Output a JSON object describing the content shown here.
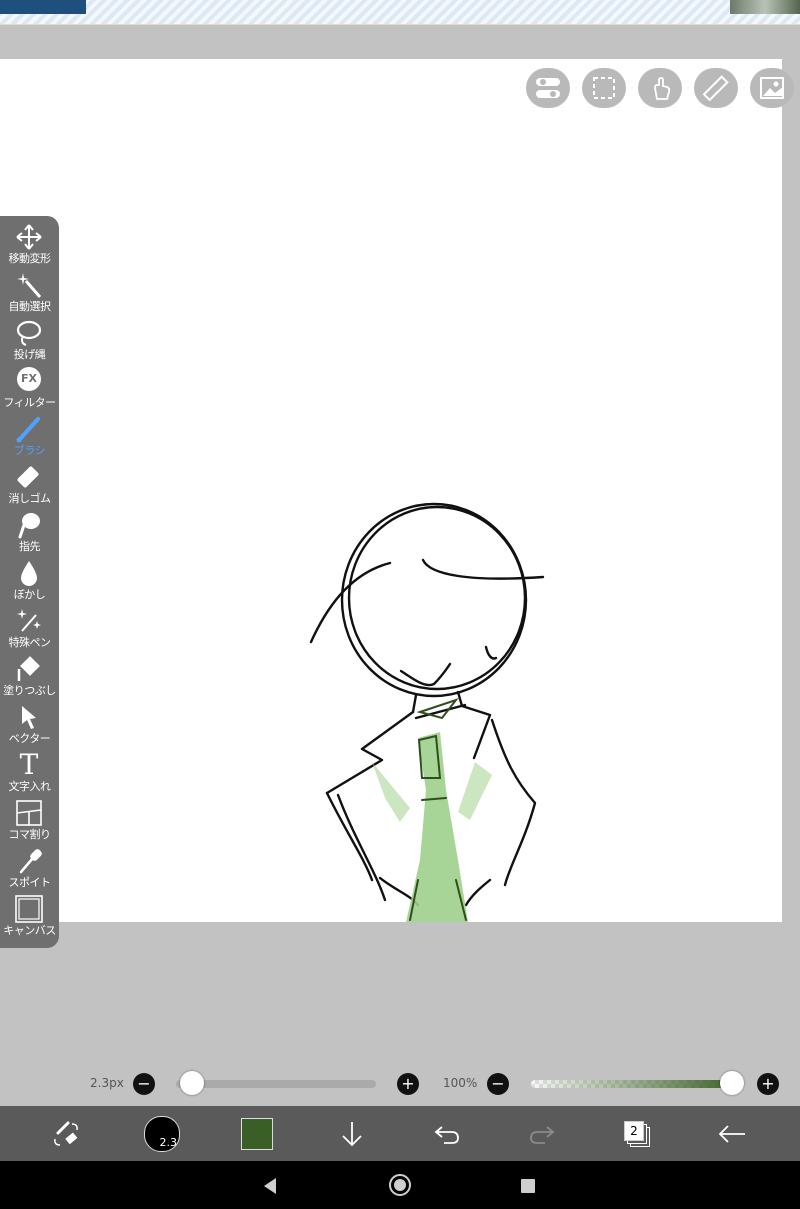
{
  "canvas_buttons": [
    "layer-toggle-icon",
    "selection-icon",
    "touch-icon",
    "ruler-icon",
    "image-icon"
  ],
  "tools": [
    {
      "label": "移動変形",
      "icon": "move-icon"
    },
    {
      "label": "自動選択",
      "icon": "magic-wand-icon"
    },
    {
      "label": "投げ縄",
      "icon": "lasso-icon"
    },
    {
      "label": "フィルター",
      "icon": "filter-icon",
      "glyph": "FX"
    },
    {
      "label": "ブラシ",
      "icon": "brush-icon",
      "active": true
    },
    {
      "label": "消しゴム",
      "icon": "eraser-icon"
    },
    {
      "label": "指先",
      "icon": "smudge-icon"
    },
    {
      "label": "ぼかし",
      "icon": "blur-icon"
    },
    {
      "label": "特殊ペン",
      "icon": "special-pen-icon"
    },
    {
      "label": "塗りつぶし",
      "icon": "fill-icon"
    },
    {
      "label": "ベクター",
      "icon": "vector-icon"
    },
    {
      "label": "文字入れ",
      "icon": "text-icon",
      "glyph": "T"
    },
    {
      "label": "コマ割り",
      "icon": "frame-divider-icon"
    },
    {
      "label": "スポイト",
      "icon": "eyedropper-icon"
    },
    {
      "label": "キャンバス",
      "icon": "canvas-icon"
    }
  ],
  "brush": {
    "size_label": "2.3px",
    "size_badge": "2.3",
    "size_fraction": 0.03,
    "opacity_label": "100%",
    "opacity_fraction": 1.0,
    "color": "#3a5f26"
  },
  "bottom": {
    "layer_count": "2"
  }
}
